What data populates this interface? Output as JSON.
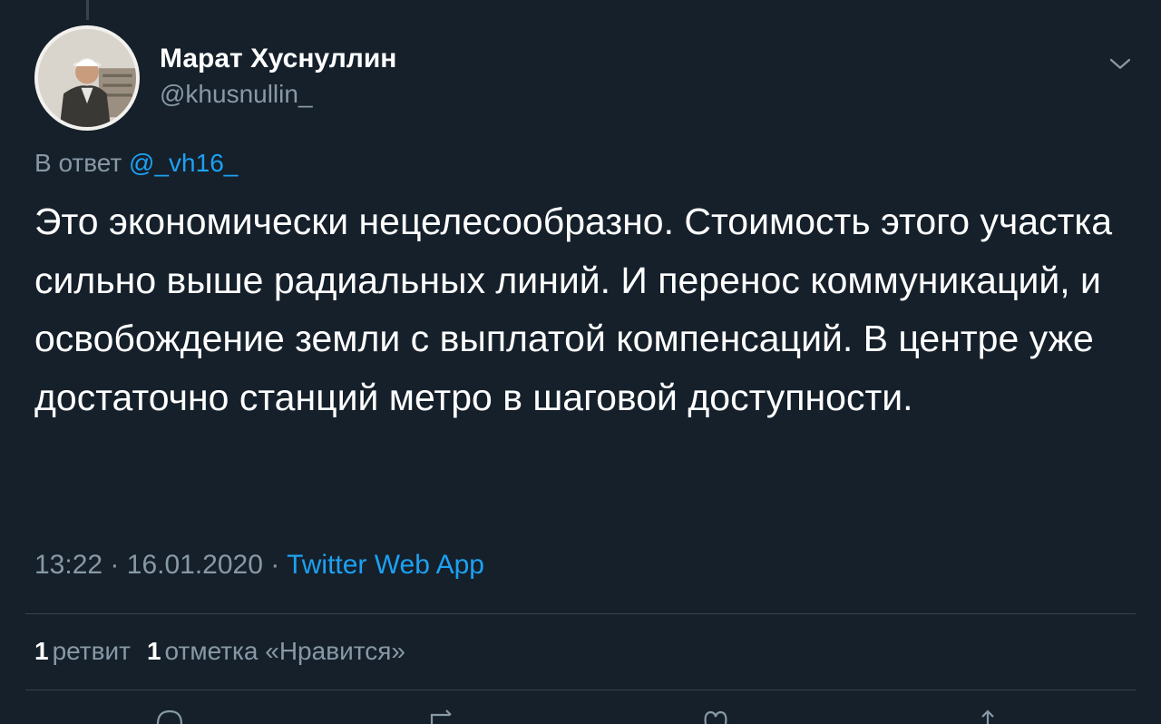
{
  "user": {
    "name": "Марат Хуснуллин",
    "handle": "@khusnullin_"
  },
  "reply": {
    "prefix": "В ответ",
    "mention": "@_vh16_"
  },
  "tweet": {
    "text": "Это экономически нецелесообразно. Стоимость этого участка сильно выше радиальных линий. И перенос коммуникаций, и освобождение земли с выплатой компенсаций. В центре уже достаточно станций метро в шаговой доступности."
  },
  "meta": {
    "time": "13:22",
    "date": "16.01.2020",
    "separator": "·",
    "source": "Twitter Web App"
  },
  "stats": {
    "retweets_count": "1",
    "retweets_label": "ретвит",
    "likes_count": "1",
    "likes_label": "отметка «Нравится»"
  },
  "icons": {
    "menu": "chevron-down-icon",
    "actions": [
      "reply-icon",
      "retweet-icon",
      "like-icon",
      "share-icon"
    ]
  },
  "colors": {
    "background": "#15202b",
    "text": "#ffffff",
    "secondary": "#8899a6",
    "accent": "#1da1f2",
    "divider": "#38444d"
  }
}
